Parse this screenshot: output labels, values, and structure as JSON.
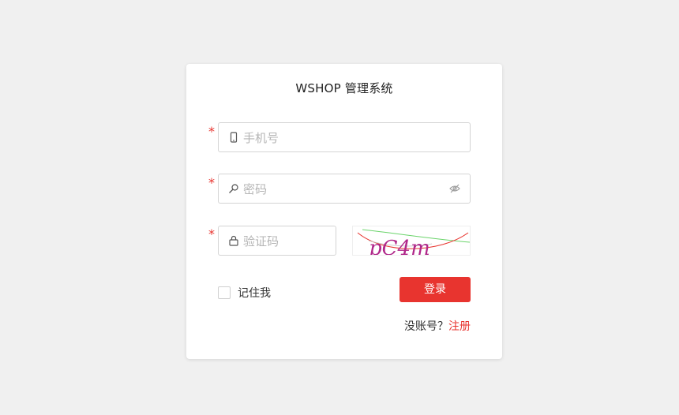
{
  "login": {
    "title": "WSHOP 管理系统",
    "required_mark": "*",
    "phone": {
      "placeholder": "手机号",
      "icon": "phone-icon"
    },
    "password": {
      "placeholder": "密码",
      "icon": "key-icon",
      "toggle_icon": "eye-off-icon"
    },
    "captcha": {
      "placeholder": "验证码",
      "icon": "lock-icon",
      "image_text": "pC4m"
    },
    "remember_label": "记住我",
    "login_button": "登录",
    "no_account_text": "没账号？",
    "register_link": "注册"
  },
  "colors": {
    "accent": "#e8342f",
    "background": "#f0f0f0",
    "card": "#ffffff",
    "placeholder": "#b5b5b5"
  }
}
